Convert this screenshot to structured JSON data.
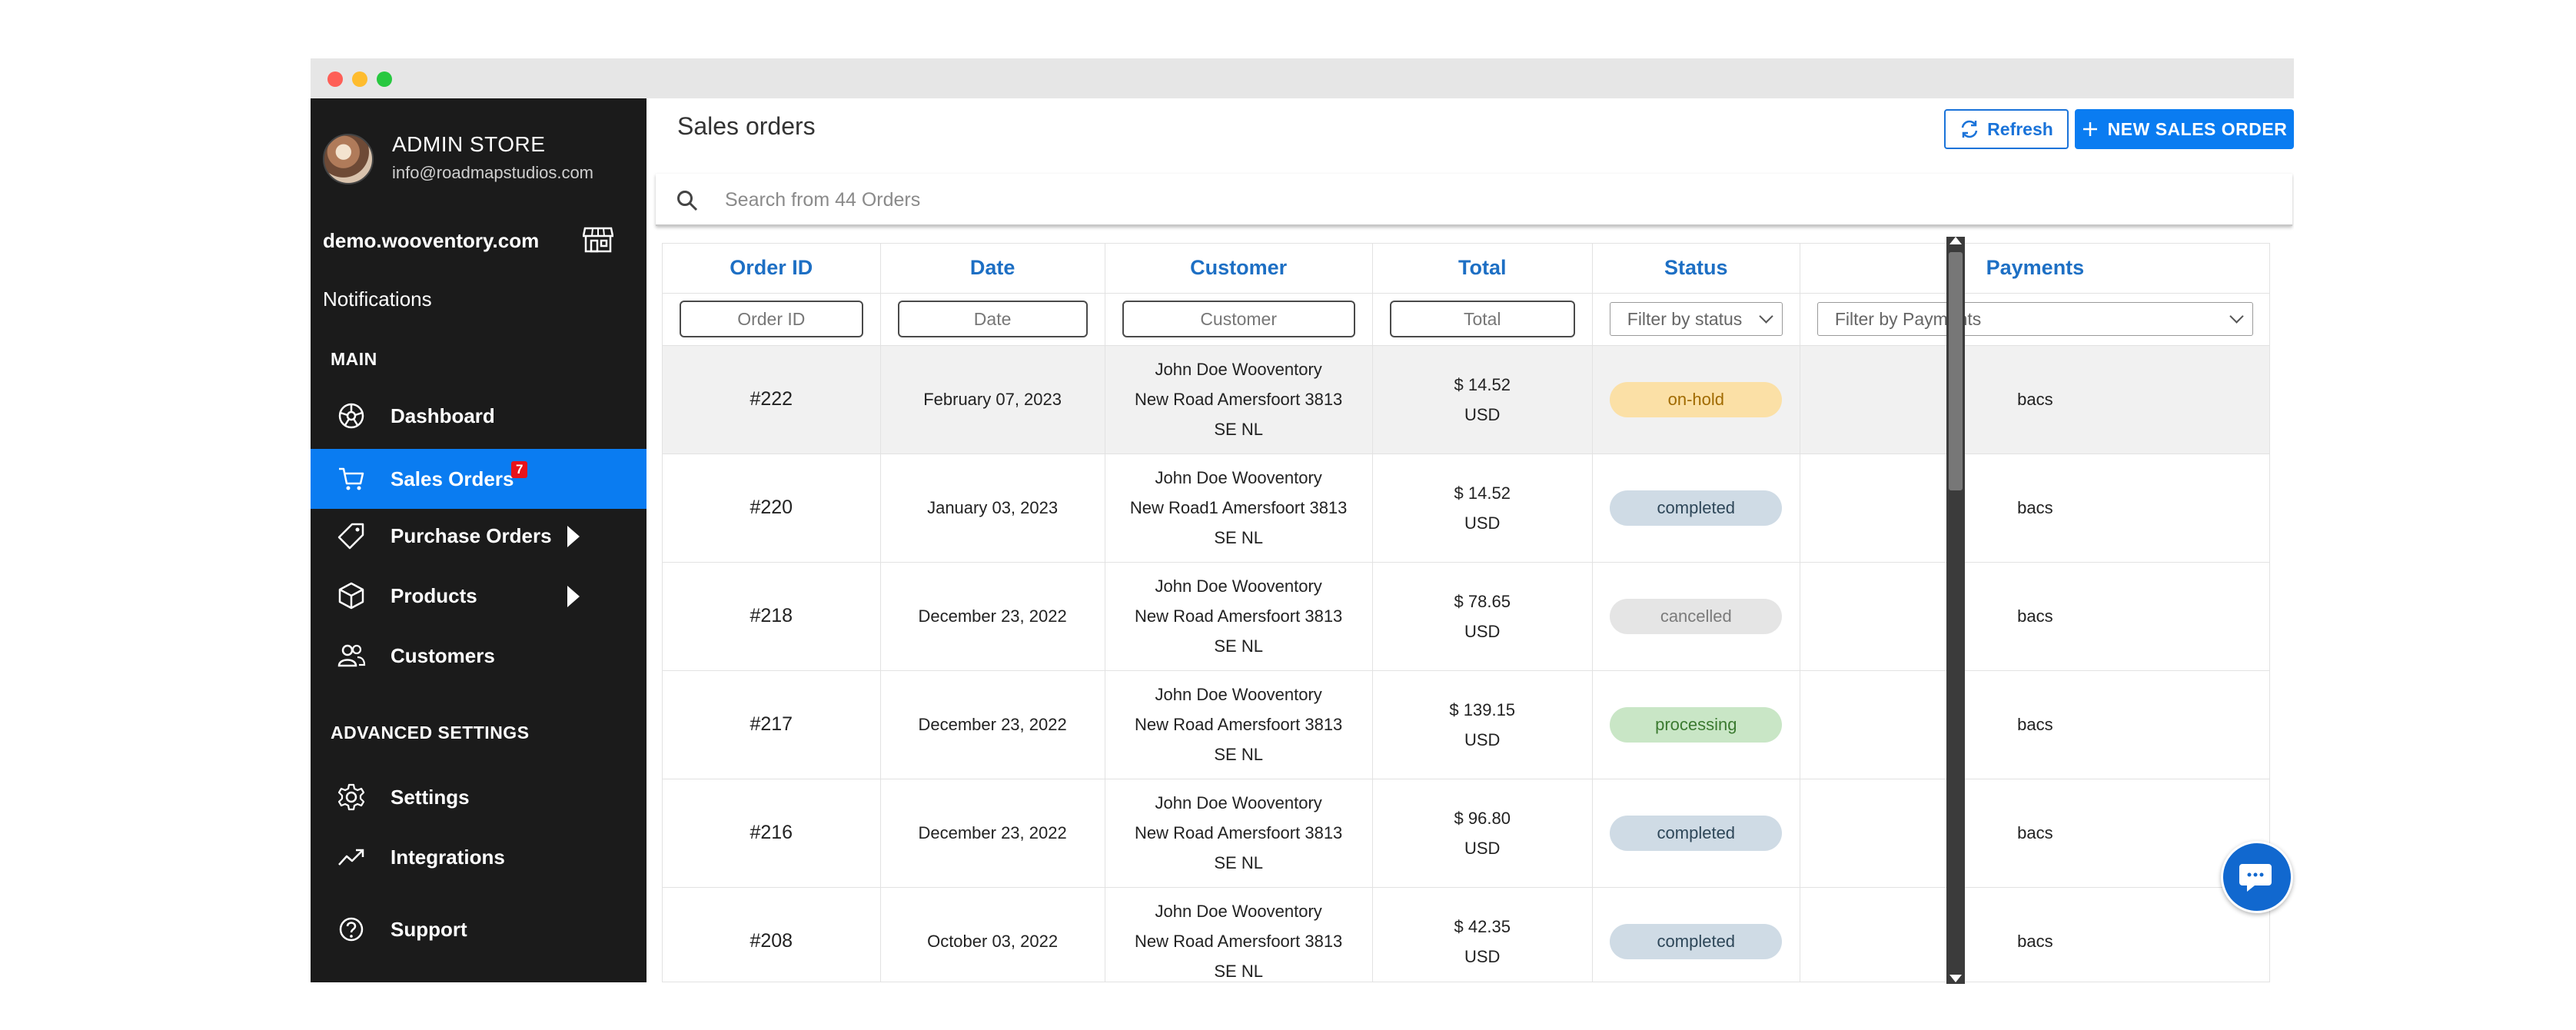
{
  "store": {
    "name": "ADMIN STORE",
    "email": "info@roadmapstudios.com",
    "domain": "demo.wooventory.com"
  },
  "sidebar": {
    "notifications": "Notifications",
    "main_label": "MAIN",
    "items": [
      {
        "label": "Dashboard",
        "icon": "dashboard-icon"
      },
      {
        "label": "Sales Orders",
        "icon": "cart-icon",
        "badge": "7",
        "active": true
      },
      {
        "label": "Purchase Orders",
        "icon": "tag-icon",
        "has_arrow": true
      },
      {
        "label": "Products",
        "icon": "box-icon",
        "has_arrow": true
      },
      {
        "label": "Customers",
        "icon": "users-icon"
      }
    ],
    "advanced_label": "ADVANCED SETTINGS",
    "advanced_items": [
      {
        "label": "Settings",
        "icon": "gear-icon"
      },
      {
        "label": "Integrations",
        "icon": "trend-icon"
      },
      {
        "label": "Support",
        "icon": "help-icon"
      }
    ]
  },
  "header": {
    "title": "Sales orders",
    "refresh_label": "Refresh",
    "new_label": "NEW SALES ORDER"
  },
  "search": {
    "placeholder": "Search from 44 Orders"
  },
  "table": {
    "columns": [
      "Order ID",
      "Date",
      "Customer",
      "Total",
      "Status",
      "Payments"
    ],
    "filters": {
      "order_id": "Order ID",
      "date": "Date",
      "customer": "Customer",
      "total": "Total",
      "status": "Filter by status",
      "payments": "Filter by Payments"
    },
    "rows": [
      {
        "id": "#222",
        "date": "February 07, 2023",
        "customer": [
          "John Doe Wooventory",
          "New Road Amersfoort 3813",
          "SE NL"
        ],
        "total": "$ 14.52",
        "currency": "USD",
        "status": "on-hold",
        "payment": "bacs"
      },
      {
        "id": "#220",
        "date": "January 03, 2023",
        "customer": [
          "John Doe Wooventory",
          "New Road1 Amersfoort 3813",
          "SE NL"
        ],
        "total": "$ 14.52",
        "currency": "USD",
        "status": "completed",
        "payment": "bacs"
      },
      {
        "id": "#218",
        "date": "December 23, 2022",
        "customer": [
          "John Doe Wooventory",
          "New Road Amersfoort 3813",
          "SE NL"
        ],
        "total": "$ 78.65",
        "currency": "USD",
        "status": "cancelled",
        "payment": "bacs"
      },
      {
        "id": "#217",
        "date": "December 23, 2022",
        "customer": [
          "John Doe Wooventory",
          "New Road Amersfoort 3813",
          "SE NL"
        ],
        "total": "$ 139.15",
        "currency": "USD",
        "status": "processing",
        "payment": "bacs"
      },
      {
        "id": "#216",
        "date": "December 23, 2022",
        "customer": [
          "John Doe Wooventory",
          "New Road Amersfoort 3813",
          "SE NL"
        ],
        "total": "$ 96.80",
        "currency": "USD",
        "status": "completed",
        "payment": "bacs"
      },
      {
        "id": "#208",
        "date": "October 03, 2022",
        "customer": [
          "John Doe Wooventory",
          "New Road Amersfoort 3813",
          "SE NL"
        ],
        "total": "$ 42.35",
        "currency": "USD",
        "status": "completed",
        "payment": "bacs"
      }
    ]
  },
  "status_colors": {
    "on-hold": {
      "bg": "#fbe0a6",
      "fg": "#a06a00"
    },
    "completed": {
      "bg": "#cfdbe5",
      "fg": "#2d4658"
    },
    "cancelled": {
      "bg": "#e5e5e5",
      "fg": "#7b7b7b"
    },
    "processing": {
      "bg": "#c9e6c6",
      "fg": "#3b7a30"
    }
  },
  "colors": {
    "accent": "#0a7cf1",
    "sidebar_bg": "#1b1b1b",
    "header_text": "#1d6fc4"
  }
}
